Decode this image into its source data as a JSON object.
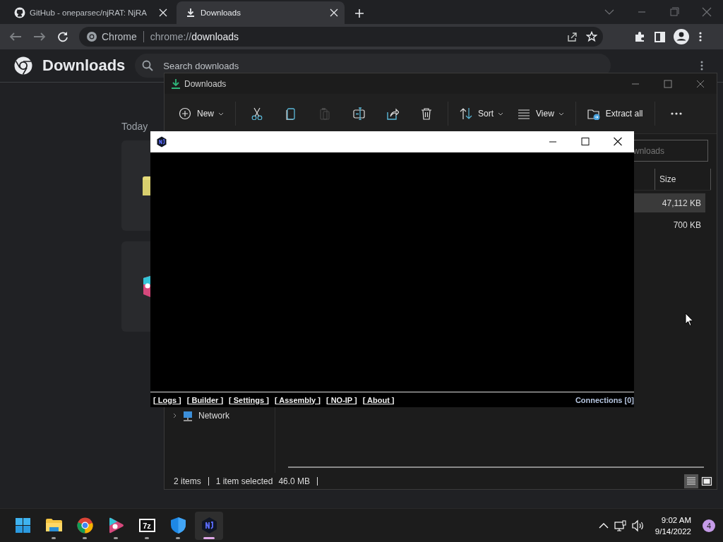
{
  "browser": {
    "tabs": [
      {
        "kind": "github",
        "title": "GitHub - oneparsec/njRAT: NjRA",
        "selected": false
      },
      {
        "kind": "download",
        "title": "Downloads",
        "selected": true
      }
    ],
    "address": {
      "chip": "Chrome",
      "scheme": "chrome://",
      "host": "downloads"
    },
    "page": {
      "title": "Downloads",
      "search": {
        "placeholder": "Search downloads"
      },
      "date_heading": "Today",
      "items": [
        {
          "kind": "folder"
        },
        {
          "kind": "app"
        }
      ]
    }
  },
  "explorer": {
    "title": "Downloads",
    "toolbar": [
      {
        "kind": "new",
        "label": "New",
        "disabled": false
      },
      {
        "kind": "cut",
        "disabled": false
      },
      {
        "kind": "copy",
        "disabled": false
      },
      {
        "kind": "paste",
        "disabled": true
      },
      {
        "kind": "rename",
        "disabled": false
      },
      {
        "kind": "share",
        "disabled": false
      },
      {
        "kind": "delete",
        "disabled": false
      },
      {
        "kind": "sort",
        "label": "Sort",
        "disabled": false
      },
      {
        "kind": "view",
        "label": "View",
        "disabled": false
      },
      {
        "kind": "extract",
        "label": "Extract all",
        "disabled": false
      },
      {
        "kind": "more",
        "disabled": false
      }
    ],
    "search": {
      "placeholder": "wnloads"
    },
    "columns": [
      "Size"
    ],
    "rows": [
      {
        "size": "47,112 KB",
        "selected": true
      },
      {
        "size": "700 KB",
        "selected": false
      }
    ],
    "nav": [
      {
        "label": "Network"
      }
    ],
    "status": {
      "count": "2 items",
      "selection": "1 item selected",
      "size": "46.0 MB"
    },
    "views": [
      {
        "kind": "details",
        "selected": true
      },
      {
        "kind": "tiles",
        "selected": false
      }
    ]
  },
  "rat": {
    "menu": [
      "[ Logs ]",
      "[ Builder ]",
      "[ Settings ]",
      "[ Assembly ]",
      "[ NO-IP ]",
      "[ About ]"
    ],
    "connections": "Connections [0]"
  },
  "taskbar": {
    "apps": [
      {
        "kind": "start",
        "running": false,
        "selected": false
      },
      {
        "kind": "files",
        "running": true,
        "selected": false
      },
      {
        "kind": "chrome",
        "running": true,
        "selected": false
      },
      {
        "kind": "ds",
        "running": true,
        "selected": false
      },
      {
        "kind": "archive",
        "label": "7z",
        "running": true,
        "selected": false
      },
      {
        "kind": "shield",
        "running": true,
        "selected": false
      },
      {
        "kind": "rat",
        "running": true,
        "selected": true
      }
    ],
    "time": "9:02 AM",
    "date": "9/14/2022",
    "notifications": "4"
  }
}
